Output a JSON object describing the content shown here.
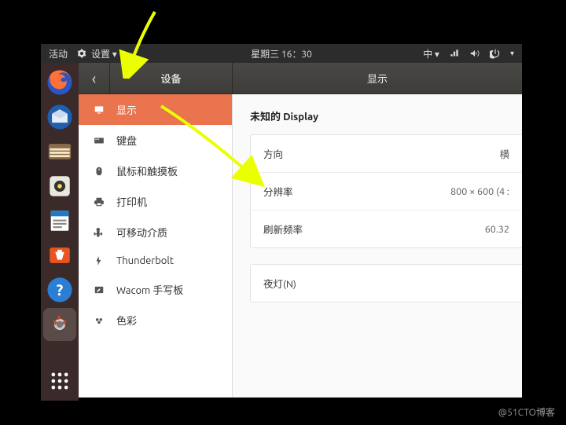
{
  "top_panel": {
    "activities": "活动",
    "app_name": "设置 ▾",
    "clock": "星期三  16：30",
    "input": "中 ▾"
  },
  "header": {
    "back_glyph": "‹",
    "left_title": "设备",
    "right_title": "显示"
  },
  "sidebar": {
    "items": [
      {
        "icon": "display",
        "label": "显示"
      },
      {
        "icon": "keyboard",
        "label": "键盘"
      },
      {
        "icon": "mouse",
        "label": "鼠标和触摸板"
      },
      {
        "icon": "printer",
        "label": "打印机"
      },
      {
        "icon": "removable",
        "label": "可移动介质"
      },
      {
        "icon": "thunderbolt",
        "label": "Thunderbolt"
      },
      {
        "icon": "wacom",
        "label": "Wacom 手写板"
      },
      {
        "icon": "color",
        "label": "色彩"
      }
    ]
  },
  "content": {
    "section_title": "未知的 Display",
    "rows": [
      {
        "label": "方向",
        "value": "横"
      },
      {
        "label": "分辨率",
        "value": "800 × 600 (4 :"
      },
      {
        "label": "刷新频率",
        "value": "60.32"
      }
    ],
    "night_light": "夜灯(N)"
  },
  "watermark": "@51CTO博客"
}
